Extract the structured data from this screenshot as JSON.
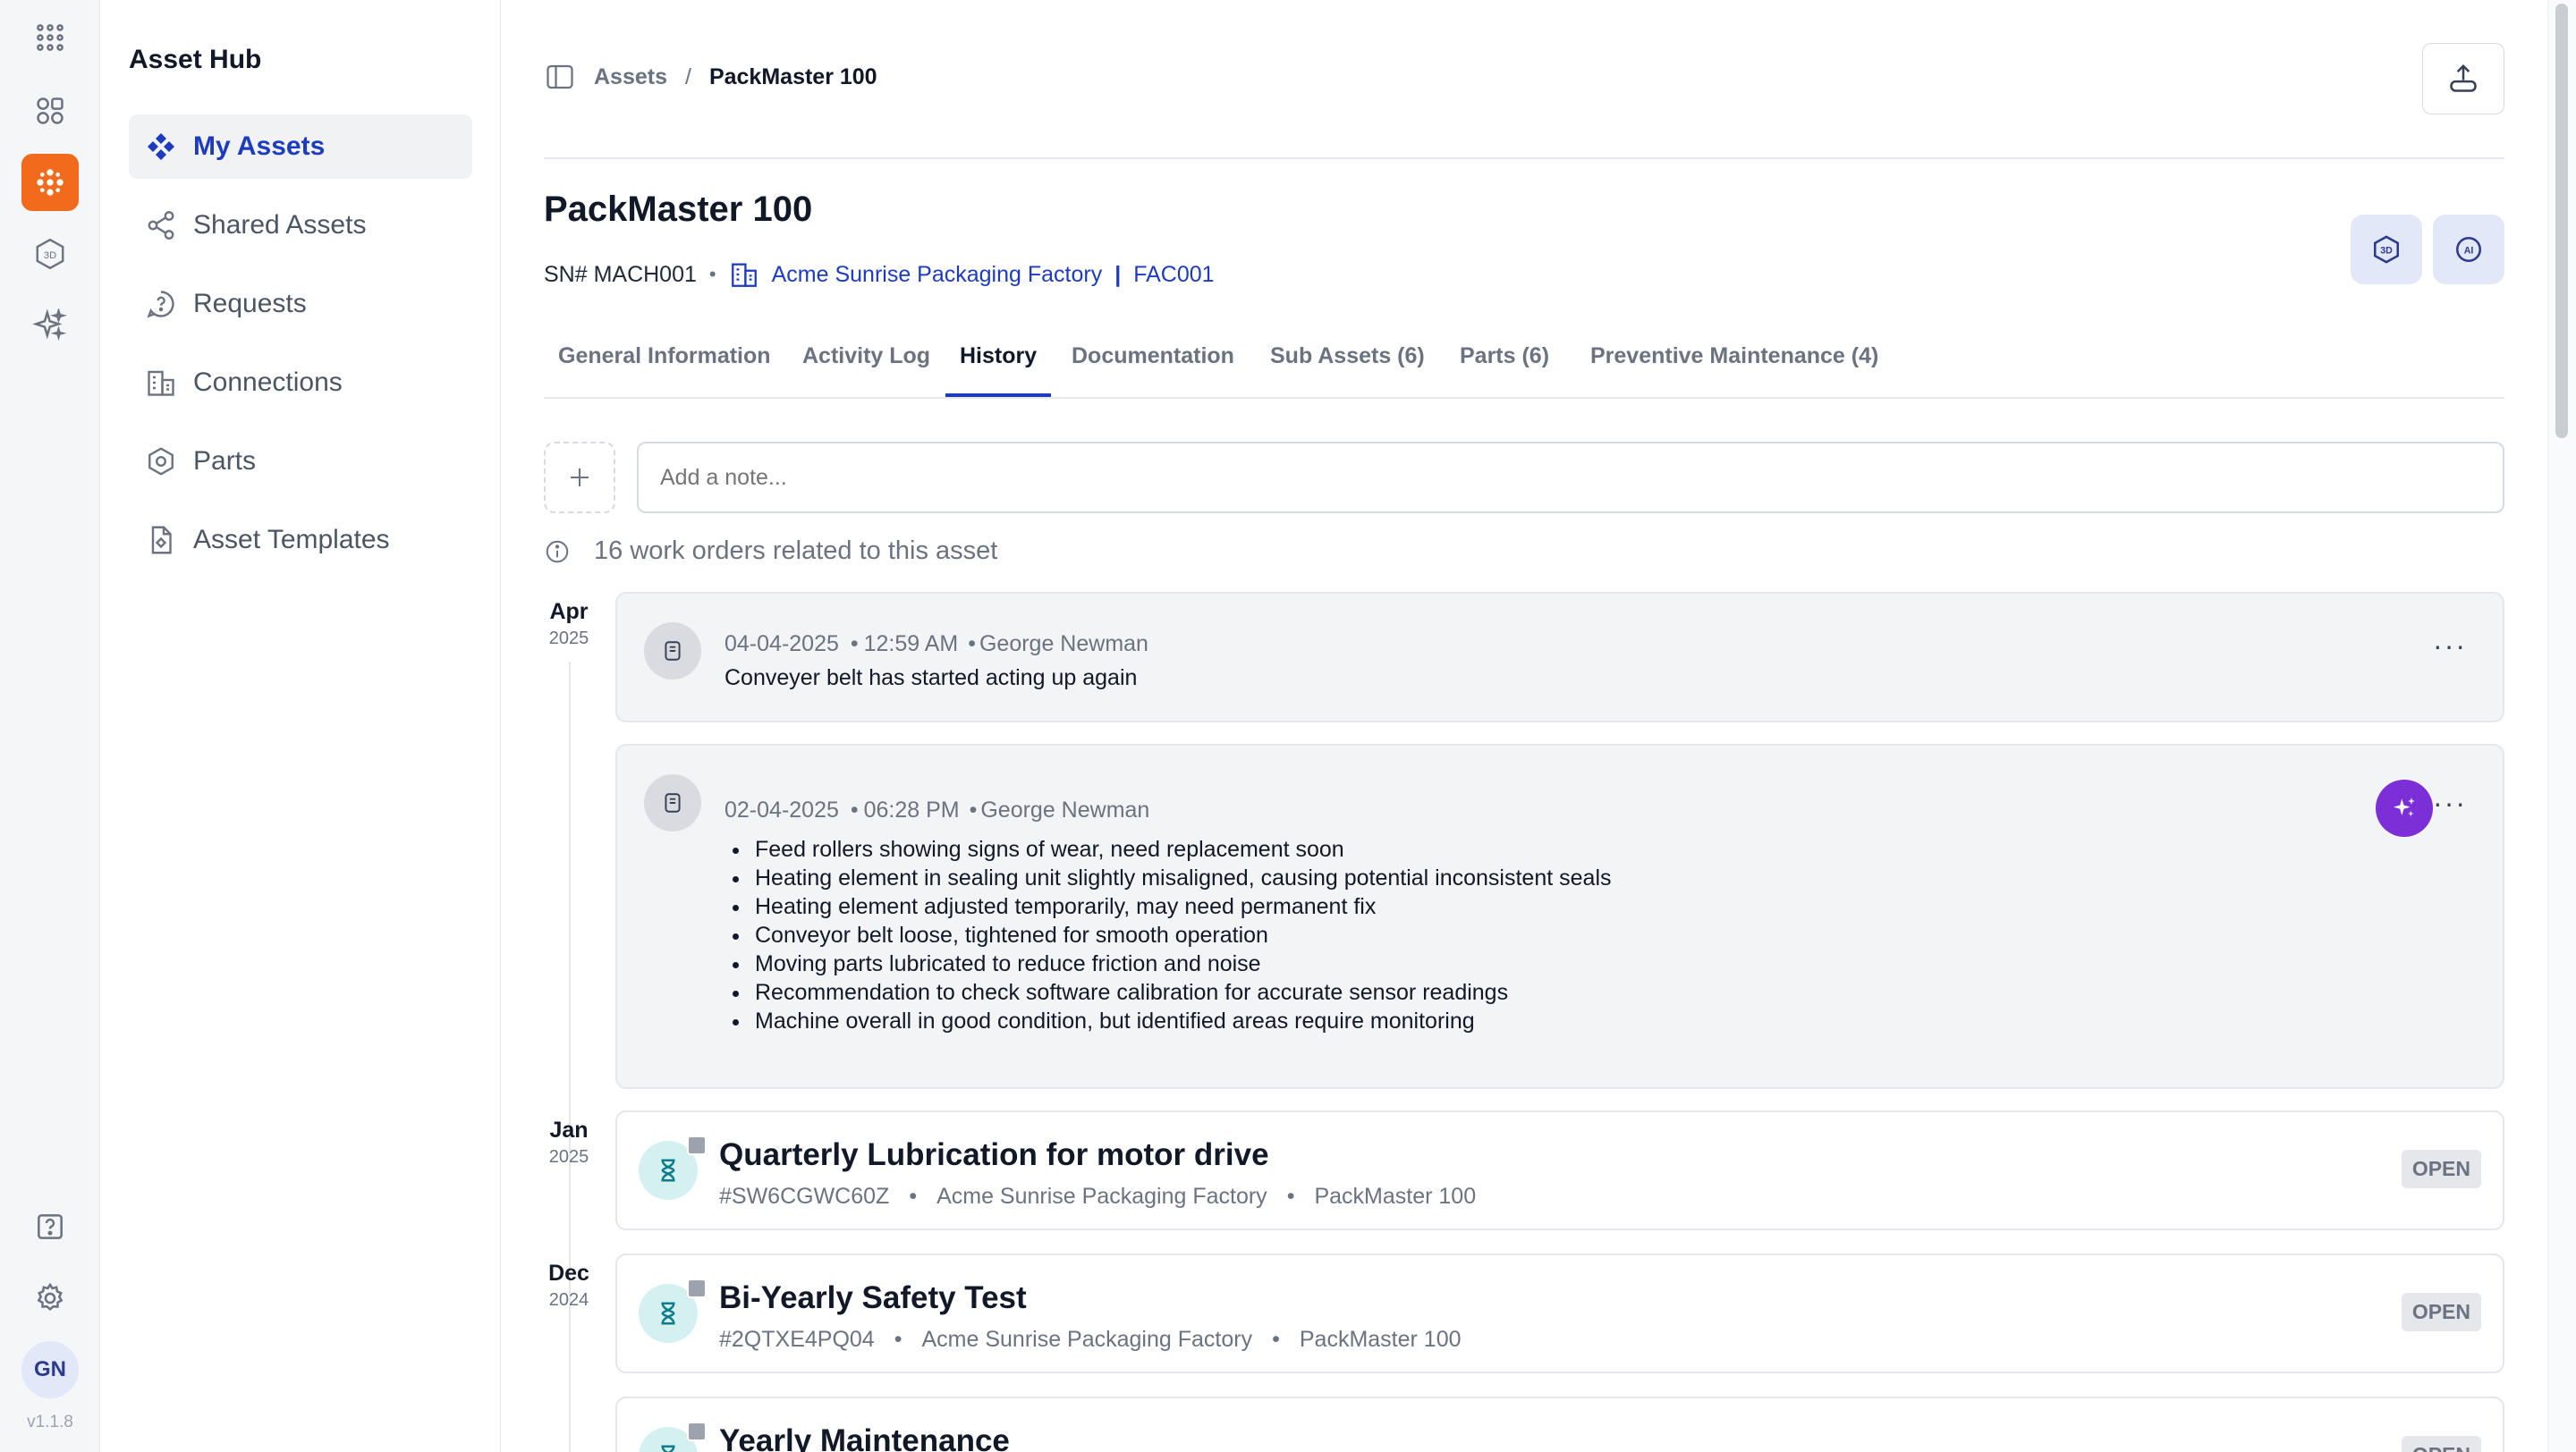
{
  "rail": {
    "version": "v1.1.8",
    "avatar": "GN"
  },
  "sidebar": {
    "title": "Asset Hub",
    "items": [
      {
        "label": "My Assets",
        "icon": "diamonds-icon",
        "active": true
      },
      {
        "label": "Shared Assets",
        "icon": "share-icon"
      },
      {
        "label": "Requests",
        "icon": "question-bubble-icon"
      },
      {
        "label": "Connections",
        "icon": "building-icon"
      },
      {
        "label": "Parts",
        "icon": "hexagon-icon"
      },
      {
        "label": "Asset Templates",
        "icon": "template-icon"
      }
    ]
  },
  "breadcrumb": {
    "parent": "Assets",
    "separator": "/",
    "current": "PackMaster 100"
  },
  "asset": {
    "title": "PackMaster 100",
    "serial": "SN# MACH001",
    "factory": "Acme Sunrise Packaging Factory",
    "factory_code": "FAC001",
    "pipe": "|",
    "dot": "•"
  },
  "tabs": [
    {
      "label": "General Information"
    },
    {
      "label": "Activity Log"
    },
    {
      "label": "History",
      "active": true
    },
    {
      "label": "Documentation"
    },
    {
      "label": "Sub Assets (6)"
    },
    {
      "label": "Parts  (6)"
    },
    {
      "label": "Preventive Maintenance (4)"
    }
  ],
  "note": {
    "placeholder": "Add a note..."
  },
  "info": {
    "text": "16 work orders related to this asset"
  },
  "months": [
    {
      "m": "Apr",
      "y": "2025"
    },
    {
      "m": "Jan",
      "y": "2025"
    },
    {
      "m": "Dec",
      "y": "2024"
    }
  ],
  "notes": [
    {
      "date": "04-04-2025",
      "time": "12:59 AM",
      "author": "George Newman",
      "text": "Conveyer belt has started acting up again"
    },
    {
      "date": "02-04-2025",
      "time": "06:28 PM",
      "author": "George Newman",
      "bullets": [
        "Feed rollers showing signs of wear, need replacement soon",
        "Heating element in sealing unit slightly misaligned, causing potential inconsistent seals",
        "Heating element adjusted temporarily, may need permanent fix",
        "Conveyor belt loose, tightened for smooth operation",
        "Moving parts lubricated to reduce friction and noise",
        "Recommendation to check software calibration for accurate sensor readings",
        "Machine overall in good condition, but identified areas require monitoring"
      ]
    }
  ],
  "work_orders": [
    {
      "title": "Quarterly Lubrication for motor drive",
      "id": "#SW6CGWC60Z",
      "factory": "Acme Sunrise Packaging Factory",
      "asset": "PackMaster 100",
      "status": "OPEN"
    },
    {
      "title": "Bi-Yearly Safety Test",
      "id": "#2QTXE4PQ04",
      "factory": "Acme Sunrise Packaging Factory",
      "asset": "PackMaster 100",
      "status": "OPEN"
    },
    {
      "title": "Yearly Maintenance",
      "status": "OPEN"
    }
  ],
  "colors": {
    "accent": "#1d3bbf",
    "rail_active": "#f26a1b",
    "ai": "#7c2fd6",
    "wo_icon_bg": "#d4f0f1"
  }
}
